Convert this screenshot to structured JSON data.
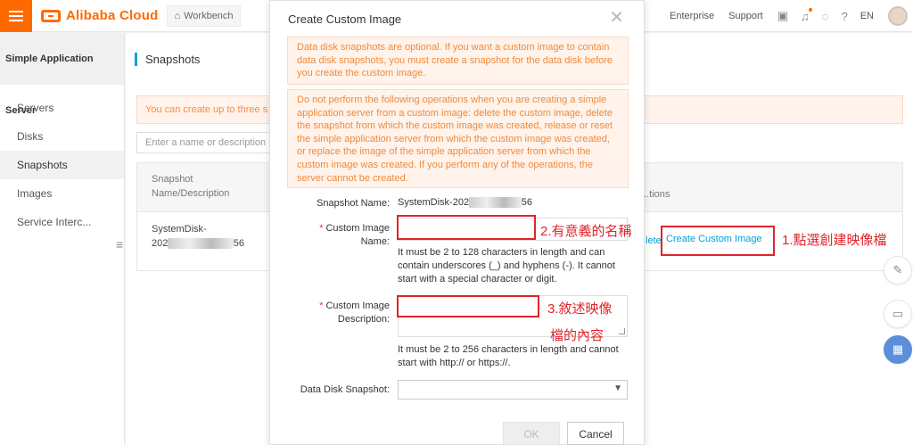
{
  "topbar": {
    "logo_text": "Alibaba Cloud",
    "workbench_label": "Workbench",
    "links": [
      "Enterprise",
      "Support"
    ],
    "language": "EN",
    "brand_color": "#ff6a00"
  },
  "sidebar": {
    "title": "Simple Application Server",
    "items": [
      {
        "label": "Servers"
      },
      {
        "label": "Disks"
      },
      {
        "label": "Snapshots"
      },
      {
        "label": "Images"
      },
      {
        "label": "Service Interc..."
      }
    ]
  },
  "main": {
    "page_title": "Snapshots",
    "notice": "You can create up to three s",
    "search_placeholder": "Enter a name or description",
    "table": {
      "col_snapshot": [
        "Snapshot",
        "Name/Description"
      ],
      "col_actions": "...tions",
      "row_name": "SystemDisk-",
      "row_name_2_prefix": "202",
      "row_name_2_suffix": "56",
      "action_delete_fragment": "lete",
      "action_create": "Create Custom Image"
    }
  },
  "dialog": {
    "title": "Create Custom Image",
    "warning_1": "Data disk snapshots are optional. If you want a custom image to contain data disk snapshots, you must create a snapshot for the data disk before you create the custom image.",
    "warning_2": "Do not perform the following operations when you are creating a simple application server from a custom image: delete the custom image, delete the snapshot from which the custom image was created, release or reset the simple application server from which the custom image was created, or replace the image of the simple application server from which the custom image was created. If you perform any of the operations, the server cannot be created.",
    "snapshot_name_label": "Snapshot Name:",
    "snapshot_name_prefix": "SystemDisk-202",
    "snapshot_name_suffix": "56",
    "custom_image_name_label": "Custom Image Name:",
    "custom_image_name_value": "",
    "custom_image_name_help": "It must be 2 to 128 characters in length and can contain underscores (_) and hyphens (-). It cannot start with a special character or digit.",
    "custom_image_desc_label": "Custom Image Description:",
    "custom_image_desc_value": "",
    "custom_image_desc_help": "It must be 2 to 256 characters in length and cannot start with http:// or https://.",
    "data_disk_label": "Data Disk Snapshot:",
    "data_disk_value": "",
    "ok_label": "OK",
    "cancel_label": "Cancel"
  },
  "annotations": {
    "step1": "1.點選創建映像檔",
    "step2": "2.有意義的名稱",
    "step3_line1": "3.敘述映像",
    "step3_line2": "檔的內容",
    "color": "#e0242b"
  }
}
